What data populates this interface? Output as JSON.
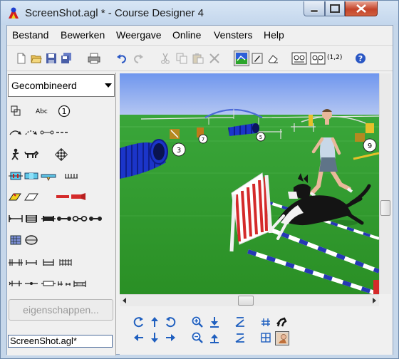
{
  "window": {
    "title": "ScreenShot.agl * - Course Designer 4"
  },
  "menu": {
    "items": [
      "Bestand",
      "Bewerken",
      "Weergave",
      "Online",
      "Vensters",
      "Help"
    ]
  },
  "toolbar": {
    "icons": [
      "new-icon",
      "open-icon",
      "save-icon",
      "save-all-icon",
      "print-icon",
      "undo-icon",
      "redo-icon",
      "cut-icon",
      "copy-icon",
      "paste-icon",
      "delete-icon",
      "3d-view-icon",
      "pen-icon",
      "eraser-icon",
      "numbering-icon",
      "renumber-icon",
      "help-icon"
    ],
    "numbering_label": "(1,2)"
  },
  "left_panel": {
    "category": "Gecombineerd",
    "text_tool_label": "Abc",
    "number_tool_label": "1",
    "properties_button": "eigenschappen...",
    "file_name": "ScreenShot.agl*"
  },
  "view": {
    "number_markers": [
      "3",
      "7",
      "5",
      "9"
    ]
  },
  "colors": {
    "grass": "#2f9b27",
    "sky": "#7fa4f2",
    "tunnel": "#1b35c9",
    "jump_red": "#d42a2a",
    "pole_blue": "#2638b5",
    "accent": "#1f5fbf"
  }
}
